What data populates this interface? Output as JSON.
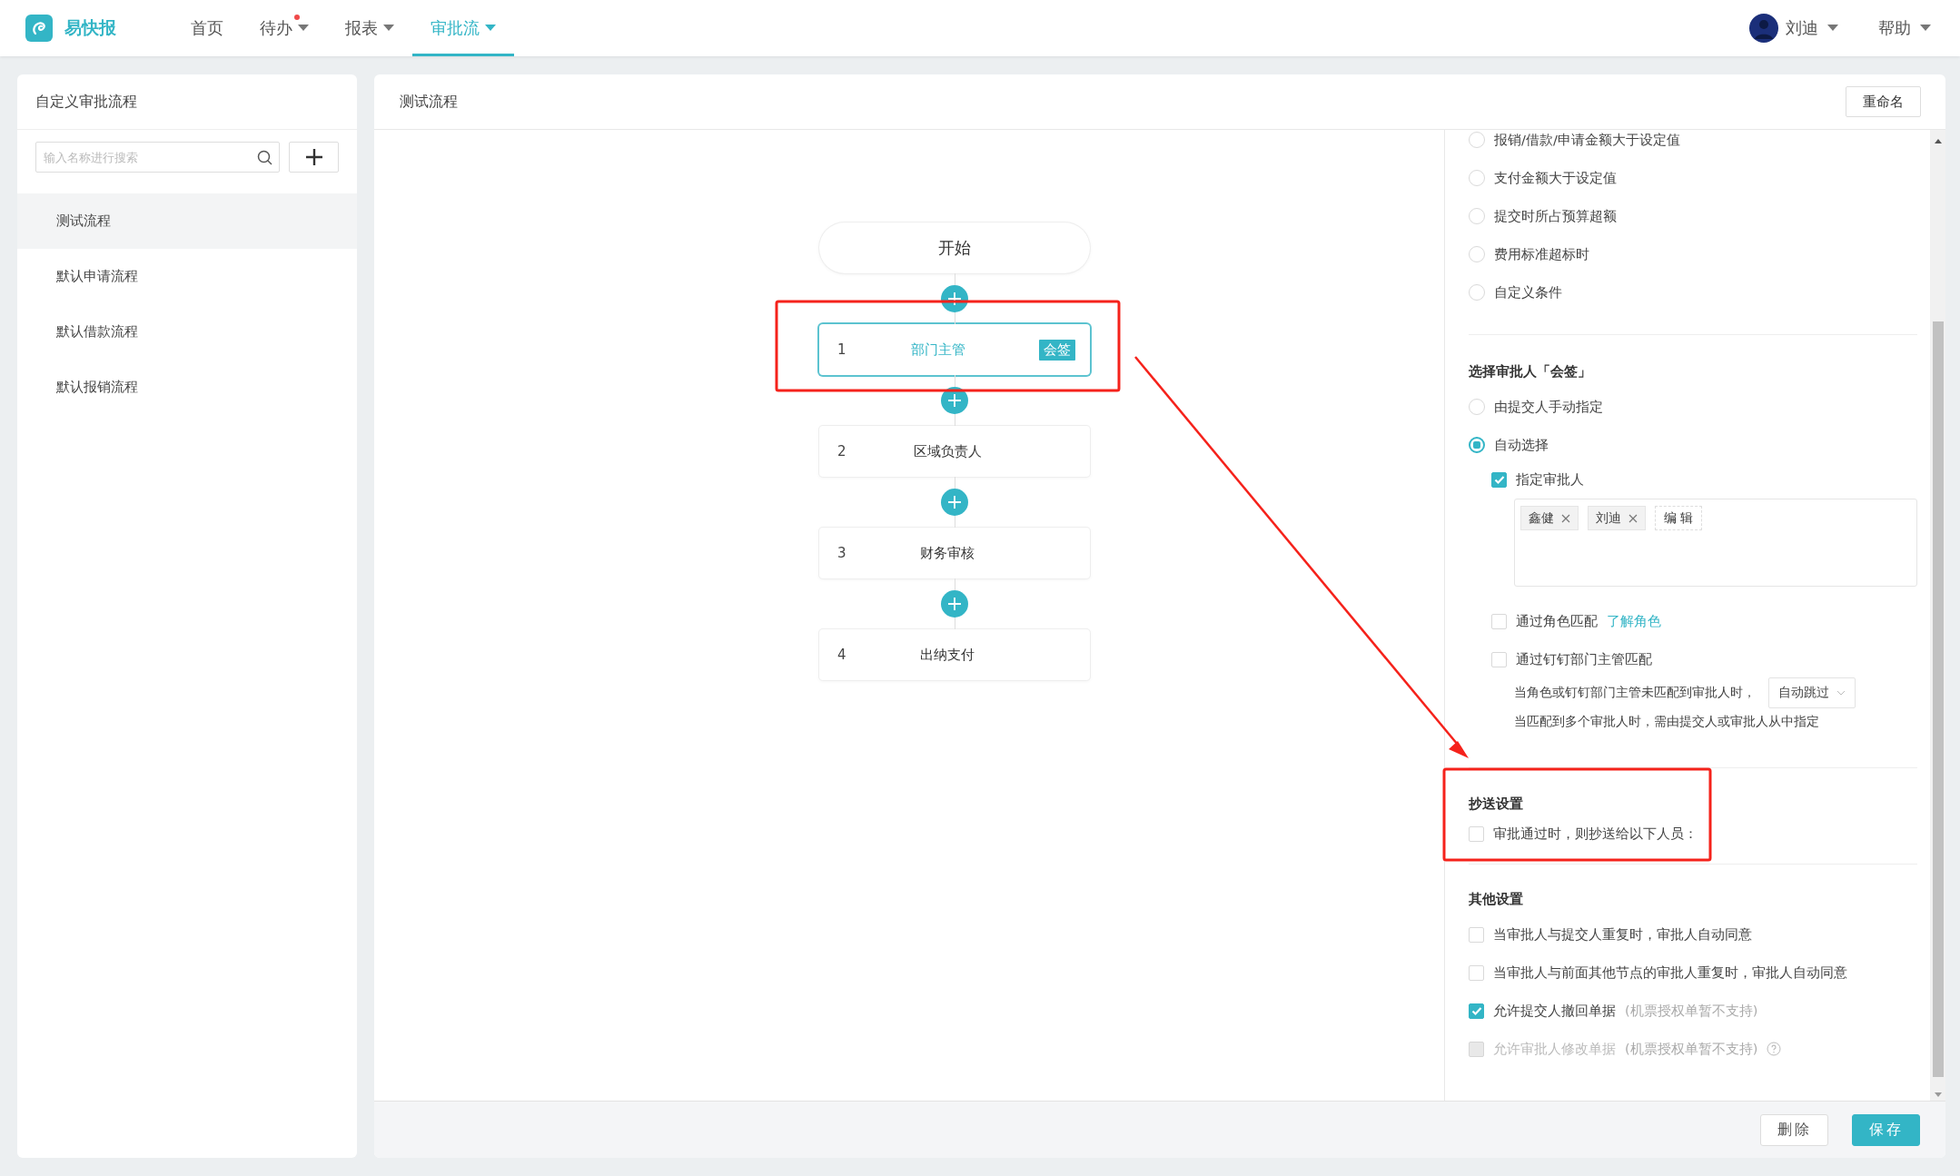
{
  "header": {
    "brand": "易快报",
    "nav": [
      {
        "label": "首页",
        "selected": false,
        "dropdown": false,
        "dot": false
      },
      {
        "label": "待办",
        "selected": false,
        "dropdown": true,
        "dot": true
      },
      {
        "label": "报表",
        "selected": false,
        "dropdown": true,
        "dot": false
      },
      {
        "label": "审批流",
        "selected": true,
        "dropdown": true,
        "dot": false
      }
    ],
    "user": "刘迪",
    "help": "帮助"
  },
  "sidebar": {
    "title": "自定义审批流程",
    "search": {
      "placeholder": "输入名称进行搜索"
    },
    "items": [
      {
        "label": "测试流程",
        "selected": true
      },
      {
        "label": "默认申请流程",
        "selected": false
      },
      {
        "label": "默认借款流程",
        "selected": false
      },
      {
        "label": "默认报销流程",
        "selected": false
      }
    ]
  },
  "editor": {
    "title": "测试流程",
    "rename_button": "重命名",
    "flow": {
      "start": "开始",
      "nodes": [
        {
          "index": "1",
          "name": "部门主管",
          "selected": true,
          "tag": "会签"
        },
        {
          "index": "2",
          "name": "区域负责人",
          "selected": false
        },
        {
          "index": "3",
          "name": "财务审核",
          "selected": false
        },
        {
          "index": "4",
          "name": "出纳支付",
          "selected": false
        }
      ]
    }
  },
  "settings": {
    "conditions": [
      {
        "label": "报销/借款/申请金额大于设定值",
        "selected": false
      },
      {
        "label": "支付金额大于设定值",
        "selected": false
      },
      {
        "label": "提交时所占预算超额",
        "selected": false
      },
      {
        "label": "费用标准超标时",
        "selected": false
      },
      {
        "label": "自定义条件",
        "selected": false
      }
    ],
    "approver": {
      "title": "选择审批人「会签」",
      "modes": [
        {
          "label": "由提交人手动指定",
          "selected": false
        },
        {
          "label": "自动选择",
          "selected": true
        }
      ],
      "designate": {
        "label": "指定审批人",
        "checked": true,
        "tags": [
          "鑫健",
          "刘迪"
        ],
        "edit": "编 辑"
      },
      "role_match": {
        "label": "通过角色匹配",
        "checked": false,
        "link": "了解角色"
      },
      "dept_match": {
        "label": "通过钉钉部门主管匹配",
        "checked": false
      },
      "fallback": {
        "text": "当角色或钉钉部门主管未匹配到审批人时，",
        "select": "自动跳过"
      },
      "note": "当匹配到多个审批人时，需由提交人或审批人从中指定"
    },
    "cc": {
      "title": "抄送设置",
      "options": [
        {
          "label": "审批通过时，则抄送给以下人员：",
          "checked": false,
          "disabled": false,
          "help": false
        }
      ]
    },
    "other": {
      "title": "其他设置",
      "options": [
        {
          "label": "当审批人与提交人重复时，审批人自动同意",
          "checked": false,
          "disabled": false,
          "help": false
        },
        {
          "label": "当审批人与前面其他节点的审批人重复时，审批人自动同意",
          "checked": false,
          "disabled": false,
          "help": false
        },
        {
          "label": "允许提交人撤回单据",
          "hint": "(机票授权单暂不支持)",
          "checked": true,
          "disabled": false,
          "help": false
        },
        {
          "label": "允许审批人修改单据",
          "hint": "(机票授权单暂不支持)",
          "checked": false,
          "disabled": true,
          "help": true
        }
      ]
    }
  },
  "footer": {
    "buttons": [
      {
        "label": "删除",
        "kind": "default"
      },
      {
        "label": "保存",
        "kind": "primary"
      }
    ]
  }
}
